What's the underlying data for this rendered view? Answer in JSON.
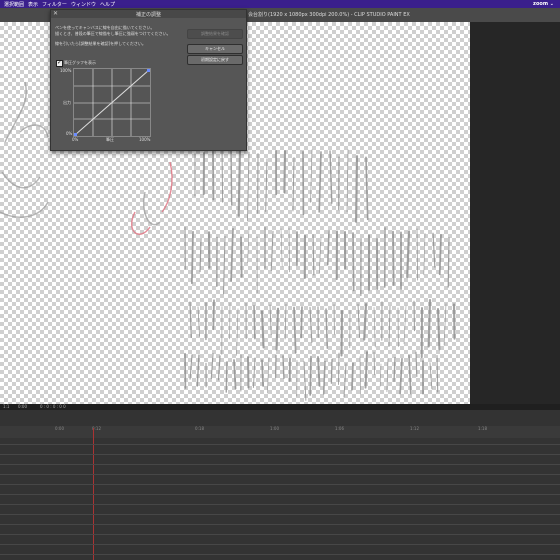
{
  "menubar": {
    "items": [
      "選択範囲",
      "表示",
      "フィルター",
      "ウィンドウ",
      "ヘルプ"
    ],
    "zoom_label": "zoom",
    "zoom_arrow": "⌄"
  },
  "window": {
    "title": "会台割り(1920 x 1080px 300dpi 200.0%) - CLIP STUDIO PAINT EX"
  },
  "dialog": {
    "title": "補正の調整",
    "close_symbol": "✕",
    "instructions": [
      "ペンを使ってキャンバスに線を自由に描いてください。",
      "描くとき、普段の筆圧で線描をし筆圧に強弱をつけてください。",
      "線を引いたら[調整結果を確認]を押してください。"
    ],
    "buttons": {
      "confirm": "調整結果を確認",
      "cancel": "キャンセル",
      "reset": "初期設定に戻す"
    },
    "checkbox_label": "筆圧グラフを表示",
    "checkbox_checked": true,
    "graph": {
      "y_top": "100%",
      "y_mid": "出力",
      "y_bottom": "0%",
      "x_left": "0%",
      "x_mid": "筆圧",
      "x_right": "100%"
    }
  },
  "timeline": {
    "header_cells": [
      "1:1",
      "0:00",
      "0 : 0 : 0 : 0 0"
    ],
    "ruler_labels": [
      "0:00",
      "0:12",
      "0:18",
      "1:00",
      "1:06",
      "1:12",
      "1:18"
    ],
    "tracks": 12
  }
}
